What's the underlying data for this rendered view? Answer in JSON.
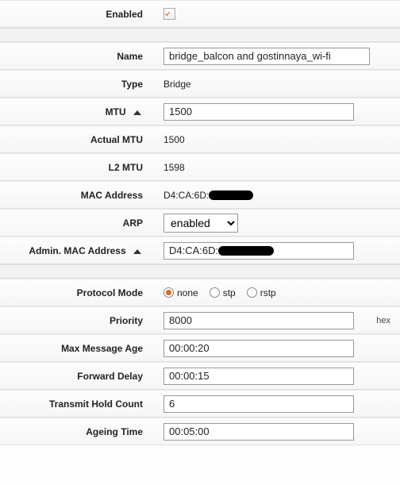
{
  "enabled": {
    "label": "Enabled",
    "checked": true
  },
  "section1": {
    "name_label": "Name",
    "name_value": "bridge_balcon and gostinnaya_wi-fi",
    "type_label": "Type",
    "type_value": "Bridge",
    "mtu_label": "MTU",
    "mtu_value": "1500",
    "actual_mtu_label": "Actual MTU",
    "actual_mtu_value": "1500",
    "l2mtu_label": "L2 MTU",
    "l2mtu_value": "1598",
    "mac_label": "MAC Address",
    "mac_prefix": "D4:CA:6D:",
    "arp_label": "ARP",
    "arp_value": "enabled",
    "admin_mac_label": "Admin. MAC Address",
    "admin_mac_value_prefix": "D4:CA:6D:"
  },
  "section2": {
    "protocol_mode_label": "Protocol Mode",
    "protocol_options": {
      "none": "none",
      "stp": "stp",
      "rstp": "rstp"
    },
    "protocol_selected": "none",
    "priority_label": "Priority",
    "priority_value": "8000",
    "priority_suffix": "hex",
    "max_msg_age_label": "Max Message Age",
    "max_msg_age_value": "00:00:20",
    "forward_delay_label": "Forward Delay",
    "forward_delay_value": "00:00:15",
    "thc_label": "Transmit Hold Count",
    "thc_value": "6",
    "ageing_label": "Ageing Time",
    "ageing_value": "00:05:00"
  }
}
